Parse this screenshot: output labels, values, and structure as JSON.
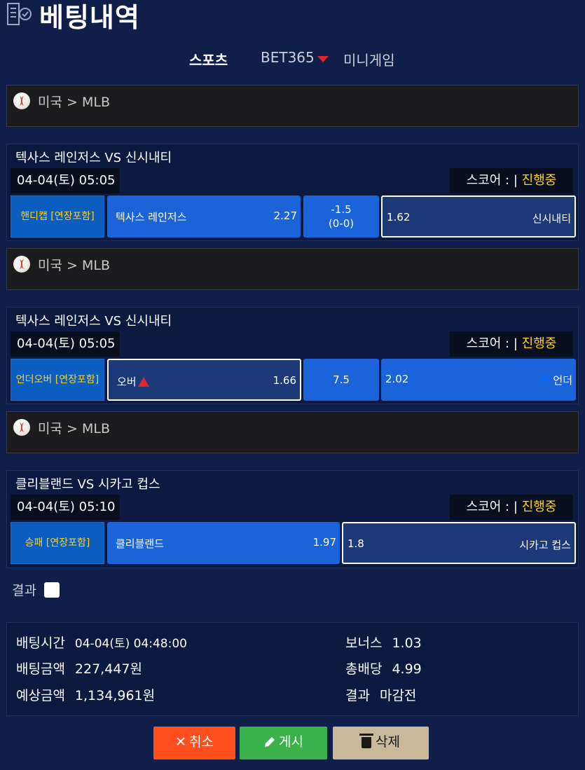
{
  "header": {
    "title": "베팅내역",
    "icon": "betting-slip-icon"
  },
  "tabs": [
    {
      "label": "스포츠",
      "active": true
    },
    {
      "label": "BET365",
      "active": false
    },
    {
      "label": "미니게임",
      "active": false
    }
  ],
  "score_label": "스코어 : |",
  "bets": [
    {
      "league": {
        "country": "미국",
        "separator": ">",
        "name": "MLB"
      },
      "teams": "텍사스 레인저스 VS 신시내티",
      "datetime": "04-04(토) 05:05",
      "status": "진행중",
      "market": "핸디캡 [연장포함]",
      "home": {
        "label": "텍사스 레인저스",
        "odds": "2.27"
      },
      "line": {
        "value": "-1.5",
        "sub": "(0-0)"
      },
      "away": {
        "label": "신시내티",
        "odds": "1.62"
      },
      "selected": "away"
    },
    {
      "league": {
        "country": "미국",
        "separator": ">",
        "name": "MLB"
      },
      "teams": "텍사스 레인저스 VS 신시내티",
      "datetime": "04-04(토) 05:05",
      "status": "진행중",
      "market": "언더오버 [연장포함]",
      "home": {
        "label": "오버",
        "odds": "1.66"
      },
      "line": {
        "value": "7.5"
      },
      "away": {
        "label": "언더",
        "odds": "2.02"
      },
      "selected": "home"
    },
    {
      "league": {
        "country": "미국",
        "separator": ">",
        "name": "MLB"
      },
      "teams": "클리블랜드 VS 시카고 컵스",
      "datetime": "04-04(토) 05:10",
      "status": "진행중",
      "market": "승패 [연장포함]",
      "home": {
        "label": "클리블랜드",
        "odds": "1.97"
      },
      "away": {
        "label": "시카고 컵스",
        "odds": "1.8"
      },
      "selected": "away"
    }
  ],
  "result_label": "결과",
  "summary": {
    "bet_time_label": "배팅시간",
    "bet_time": "04-04(토) 04:48:00",
    "bet_amount_label": "배팅금액",
    "bet_amount": "227,447원",
    "expected_label": "예상금액",
    "expected": "1,134,961원",
    "bonus_label": "보너스",
    "bonus": "1.03",
    "total_odds_label": "총배당",
    "total_odds": "4.99",
    "result_label": "결과",
    "result": "마감전"
  },
  "buttons": {
    "cancel": "취소",
    "post": "게시",
    "delete": "삭제"
  },
  "colors": {
    "background": "#0f1f4a",
    "odd_button": "#1a63d8",
    "status": "#ffd21a",
    "cancel": "#ff4f1f",
    "post": "#3bb14a",
    "delete": "#c8b99a"
  }
}
